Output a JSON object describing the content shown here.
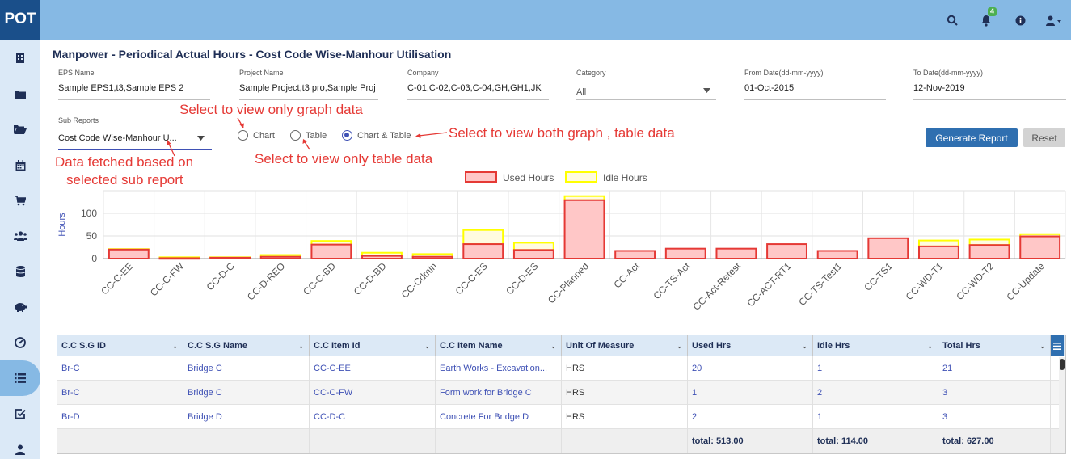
{
  "app": {
    "logo": "POT",
    "notifications_count": "4"
  },
  "top_icons": [
    "search-icon",
    "bell-icon",
    "info-icon",
    "user-icon"
  ],
  "sidebar_icons": [
    "building-icon",
    "folder-icon",
    "folder-open-icon",
    "calendar-icon",
    "cart-icon",
    "users-icon",
    "database-icon",
    "piggy-bank-icon",
    "dashboard-icon",
    "list-icon",
    "check-square-icon",
    "user-icon"
  ],
  "page": {
    "title": "Manpower - Periodical Actual Hours - Cost Code Wise-Manhour Utilisation"
  },
  "filters": {
    "eps": {
      "label": "EPS Name",
      "value": "Sample EPS1,t3,Sample EPS 2"
    },
    "project": {
      "label": "Project Name",
      "value": "Sample Project,t3 pro,Sample Proj"
    },
    "company": {
      "label": "Company",
      "value": "C-01,C-02,C-03,C-04,GH,GH1,JK"
    },
    "category": {
      "label": "Category",
      "value": "All"
    },
    "from_date": {
      "label": "From Date(dd-mm-yyyy)",
      "value": "01-Oct-2015"
    },
    "to_date": {
      "label": "To Date(dd-mm-yyyy)",
      "value": "12-Nov-2019"
    },
    "sub_reports": {
      "label": "Sub Reports",
      "value": "Cost Code Wise-Manhour U..."
    }
  },
  "view_options": {
    "chart": "Chart",
    "table": "Table",
    "chart_table": "Chart & Table",
    "selected": "chart_table"
  },
  "buttons": {
    "generate": "Generate Report",
    "reset": "Reset"
  },
  "annotations": {
    "graph_only": "Select to view only graph data",
    "table_only": "Select to view only table data",
    "both": "Select to view both graph , table data",
    "fetched_line1": "Data fetched based on",
    "fetched_line2": "selected sub report"
  },
  "chart_data": {
    "type": "bar",
    "ylabel": "Hours",
    "yticks": [
      "0",
      "50",
      "100"
    ],
    "ylim": [
      0,
      150
    ],
    "legend": {
      "position": "top-center"
    },
    "categories": [
      "CC-C-EE",
      "CC-C-FW",
      "CC-D-C",
      "CC-D-REO",
      "CC-C-BD",
      "CC-D-BD",
      "CC-Cdmin",
      "CC-C-ES",
      "CC-D-ES",
      "CC-Planned",
      "CC-Act",
      "CC-TS-Act",
      "CC-Act-Retest",
      "CC-ACT-RT1",
      "CC-TS-Test1",
      "CC-TS1",
      "CC-WD-T1",
      "CC-WD-T2",
      "CC-Update"
    ],
    "series": [
      {
        "name": "Used Hours",
        "values": [
          20,
          1,
          2,
          4,
          31,
          6,
          4,
          32,
          19,
          129,
          17,
          22,
          22,
          32,
          17,
          45,
          27,
          30,
          49
        ],
        "color": "#e53935",
        "fill": "#ffc7c7"
      },
      {
        "name": "Idle Hours",
        "values": [
          1,
          2,
          1,
          4,
          8,
          7,
          6,
          31,
          16,
          9,
          0,
          0,
          0,
          0,
          0,
          0,
          13,
          12,
          5
        ],
        "color": "#ffff00"
      }
    ]
  },
  "table": {
    "columns": [
      "C.C S.G ID",
      "C.C S.G Name",
      "C.C Item Id",
      "C.C Item Name",
      "Unit Of Measure",
      "Used Hrs",
      "Idle Hrs",
      "Total Hrs"
    ],
    "rows": [
      [
        "Br-C",
        "Bridge C",
        "CC-C-EE",
        "Earth Works - Excavation...",
        "HRS",
        "20",
        "1",
        "21"
      ],
      [
        "Br-C",
        "Bridge C",
        "CC-C-FW",
        "Form work for Bridge C",
        "HRS",
        "1",
        "2",
        "3"
      ],
      [
        "Br-D",
        "Bridge D",
        "CC-D-C",
        "Concrete For Bridge D",
        "HRS",
        "2",
        "1",
        "3"
      ]
    ],
    "totals": {
      "used": "total: 513.00",
      "idle": "total: 114.00",
      "total": "total: 627.00"
    }
  }
}
